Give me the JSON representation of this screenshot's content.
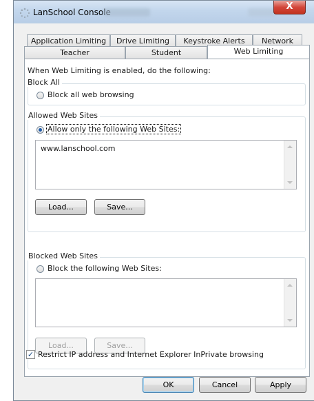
{
  "window": {
    "title": "LanSchool Console",
    "close_glyph": "X",
    "icon": "lanschool-spinner-icon"
  },
  "tabs": {
    "row1": [
      "Application Limiting",
      "Drive Limiting",
      "Keystroke Alerts",
      "Network"
    ],
    "row2": [
      "Teacher",
      "Student",
      "Web Limiting"
    ],
    "active": "Web Limiting"
  },
  "web_limiting": {
    "intro": "When Web Limiting is enabled, do the following:",
    "block_all": {
      "group_label": "Block All",
      "radio_label": "Block all web browsing",
      "selected": false
    },
    "allowed": {
      "group_label": "Allowed Web Sites",
      "radio_label": "Allow only the following Web Sites:",
      "selected": true,
      "sites": "www.lanschool.com",
      "load_label": "Load...",
      "save_label": "Save..."
    },
    "blocked": {
      "group_label": "Blocked Web Sites",
      "radio_label": "Block the following Web Sites:",
      "selected": false,
      "sites": "",
      "load_label": "Load...",
      "save_label": "Save..."
    },
    "restrict_checkbox": {
      "label": "Restrict IP address and Internet Explorer InPrivate browsing",
      "checked": true
    }
  },
  "footer": {
    "ok_label": "OK",
    "cancel_label": "Cancel",
    "apply_label": "Apply"
  },
  "colors": {
    "title_bar": "#c2d6ec",
    "close_button": "#d3463a",
    "accent_green": "#4fa23a",
    "radio_selected": "#1e5aa8"
  }
}
